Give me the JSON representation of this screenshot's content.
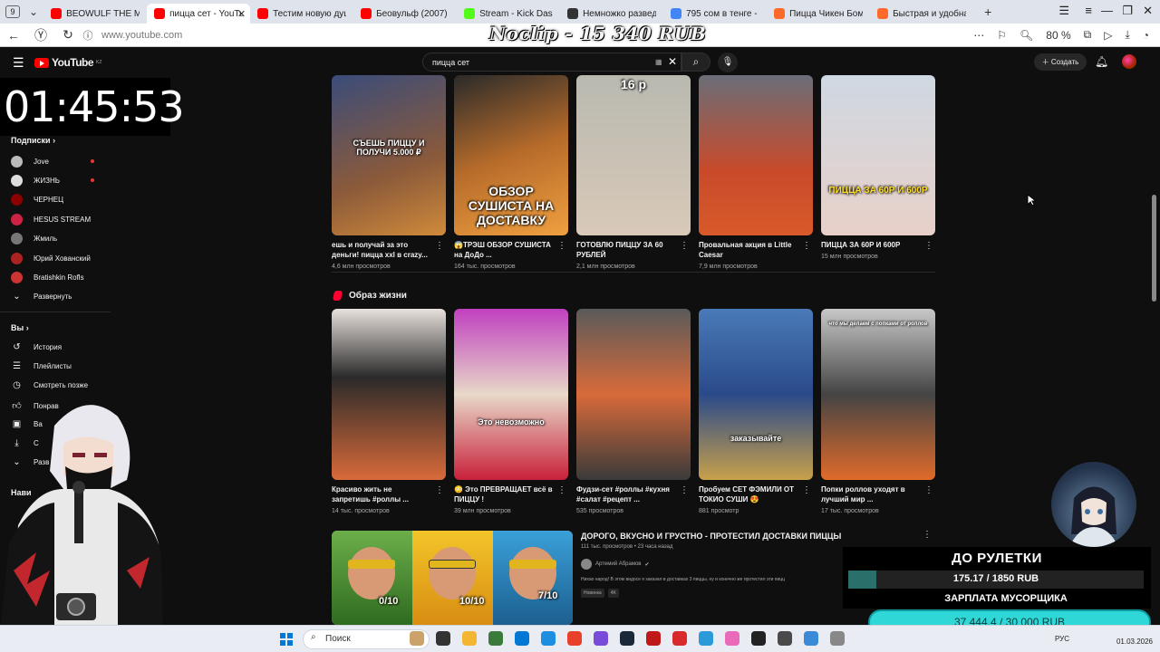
{
  "browser": {
    "tab_count": "9",
    "tabs": [
      {
        "title": "BEOWULF THE MIGH",
        "color": "#ff0000"
      },
      {
        "title": "пицца сет - YouTu",
        "color": "#ff0000",
        "active": true
      },
      {
        "title": "Тестим новую душе",
        "color": "#ff0000"
      },
      {
        "title": "Беовульф (2007) - Yo",
        "color": "#ff0000"
      },
      {
        "title": "Stream - Kick Dashbo",
        "color": "#53fc18"
      },
      {
        "title": "Немножко разведен",
        "color": "#333333"
      },
      {
        "title": "795 сом в тенге - Пои",
        "color": "#4285f4"
      },
      {
        "title": "Пицца Чикен Бомбо",
        "color": "#ff6a2a"
      },
      {
        "title": "Быстрая и удобная д",
        "color": "#ff6a2a"
      }
    ],
    "url": "www.youtube.com",
    "zoom": "80 %"
  },
  "donation_overlay": "Noclip - 15 340 RUB",
  "youtube": {
    "logo": "YouTube",
    "logo_region": "KZ",
    "search_value": "пицца сет",
    "create_label": "Создать"
  },
  "timer": "01:45:53",
  "sidebar": {
    "subs_title": "Подписки",
    "subs": [
      {
        "name": "Jove",
        "color": "#bbbbbb"
      },
      {
        "name": "ЖИЗНЬ",
        "color": "#dddddd"
      },
      {
        "name": "ЧЕРНЕЦ",
        "color": "#8b0000"
      },
      {
        "name": "HESUS STREAM",
        "color": "#cc2244"
      },
      {
        "name": "Жмиль",
        "color": "#777777"
      },
      {
        "name": "Юрий Хованский",
        "color": "#aa2222"
      },
      {
        "name": "Bratishkin Rofls",
        "color": "#cc3333"
      }
    ],
    "expand_label": "Развернуть",
    "you_title": "Вы",
    "you_items": [
      {
        "label": "История",
        "icon": "history-icon"
      },
      {
        "label": "Плейлисты",
        "icon": "playlist-icon"
      },
      {
        "label": "Смотреть позже",
        "icon": "clock-icon"
      },
      {
        "label": "Понрав",
        "icon": "like-icon"
      },
      {
        "label": "Ва",
        "icon": "video-icon"
      },
      {
        "label": "С",
        "icon": "download-icon"
      },
      {
        "label": "Разв",
        "icon": "chevron-down-icon"
      }
    ],
    "nav_title": "Нави"
  },
  "row1": [
    {
      "title": "ешь и получай за это деньги! пицца xxl в crazy...",
      "meta": "4,6 млн просмотров",
      "overlay": "СЪЕШЬ ПИЦЦУ И ПОЛУЧИ 5.000 ₽"
    },
    {
      "title": "😱ТРЭШ ОБЗОР СУШИСТА на ДоДо ...",
      "meta": "164 тыс. просмотров",
      "overlay": "ОБЗОР СУШИСТА НА ДОСТАВКУ"
    },
    {
      "title": "ГОТОВЛЮ ПИЦЦУ ЗА 60 РУБЛЕЙ",
      "meta": "2,1 млн просмотров",
      "overlay": "16 р"
    },
    {
      "title": "Провальная акция в Little Caesar",
      "meta": "7,9 млн просмотров",
      "overlay": ""
    },
    {
      "title": "ПИЦЦА ЗА 60Р И 600Р",
      "meta": "15 млн просмотров",
      "overlay": "ПИЦЦА ЗА 60Р И 600Р"
    }
  ],
  "section_title": "Образ жизни",
  "row2": [
    {
      "title": "Красиво жить не запретишь #роллы ...",
      "meta": "14 тыс. просмотров",
      "overlay": ""
    },
    {
      "title": "😳 Это ПРЕВРАЩАЕТ всё в ПИЦЦУ !",
      "meta": "39 млн просмотров",
      "overlay": "Это невозможно"
    },
    {
      "title": "Фудзи-сет #роллы #кухня #салат #рецепт ...",
      "meta": "535 просмотров",
      "overlay": ""
    },
    {
      "title": "Пробуем СЕТ ФЭМИЛИ ОТ ТОКИО СУШИ 😍",
      "meta": "881 просмотр",
      "overlay": "заказывайте"
    },
    {
      "title": "Попки роллов уходят в лучший мир ...",
      "meta": "17 тыс. просмотров",
      "overlay": "что мы делаем с попками от роллов"
    }
  ],
  "long_video": {
    "title": "ДОРОГО, ВКУСНО И ГРУСТНО - ПРОТЕСТИЛ ДОСТАВКИ ПИЦЦЫ",
    "meta": "111 тыс. просмотров • 23 часа назад",
    "channel": "Артемий Абрамов",
    "description": "Нихао народ! В этом видосе я заказал в доставках 3 пиццы, ну и конечно же протестил эти пицц",
    "badge_new": "Новинка",
    "badge_4k": "4K",
    "scores": [
      "0/10",
      "10/10",
      "7/10"
    ]
  },
  "roulette": {
    "title": "ДО РУЛЕТКИ",
    "progress_text": "175.17 / 1850 RUB",
    "progress_fraction": 0.0947,
    "subtitle": "ЗАРПЛАТА МУСОРЩИКА"
  },
  "salary": {
    "text": "37 444.4 / 30 000 RUB",
    "progress_fraction": 1.0
  },
  "taskbar": {
    "search_label": "Поиск",
    "lang": "РУС",
    "date": "01.03.2026"
  }
}
